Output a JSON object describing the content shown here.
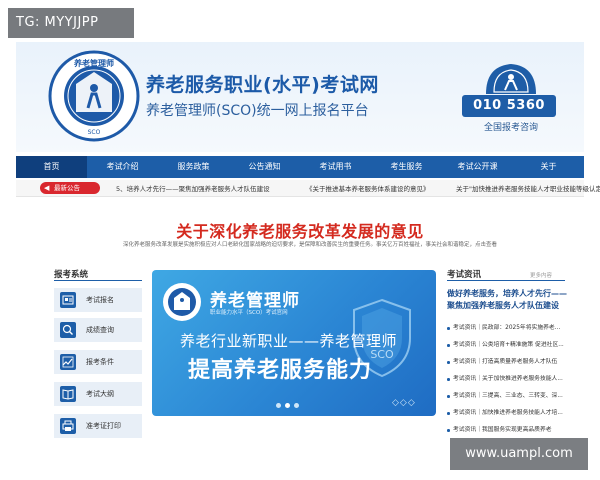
{
  "watermarks": {
    "top_left": "TG: MYYJJPP",
    "bottom_right": "www.uampl.com"
  },
  "header": {
    "title": "养老服务职业(水平)考试网",
    "subtitle": "养老管理师(SCO)统一网上报名平台",
    "logo_top_text": "养老管理师",
    "logo_side_text": "SENIOR CARE SERVICE MANAGER",
    "logo_bottom_text": "SCO",
    "phone": "010 5360 5360",
    "phone_label": "全国报考咨询"
  },
  "nav": {
    "items": [
      "首页",
      "考试介绍",
      "服务政策",
      "公告通知",
      "考试用书",
      "考生服务",
      "考试公开课",
      "关于"
    ],
    "active_index": 0
  },
  "notice": {
    "badge": "最新公告",
    "items": [
      "5、培养人才先行——聚焦加强养老服务人才队伍建设",
      "《关于推进基本养老服务体系建设的意见》",
      "关于\"加快推进养老服务技能人才职业技能等级认定"
    ]
  },
  "headline": "关于深化养老服务改革发展的意见",
  "lead": "深化养老服务改革发展是实施积极应对人口老龄化国家战略的迫切要求，是保障和改善民生的重要任务。事关亿万百姓福祉，事关社会和谐稳定，点击查看",
  "sidebar": {
    "title": "报考系统",
    "items": [
      {
        "label": "考试报名",
        "icon": "id-card-icon"
      },
      {
        "label": "成绩查询",
        "icon": "search-icon"
      },
      {
        "label": "报考条件",
        "icon": "chart-icon"
      },
      {
        "label": "考试大纲",
        "icon": "book-icon"
      },
      {
        "label": "准考证打印",
        "icon": "printer-icon"
      }
    ]
  },
  "banner": {
    "title": "养老管理师",
    "subtitle": "职业能力水平（SCO）考试官网",
    "slogan": "养老行业新职业——养老管理师",
    "main": "提高养老服务能力",
    "shield_text": "SCO",
    "slide_count": 3,
    "active_slide": 1,
    "arrows": "◇◇◇"
  },
  "news": {
    "title": "考试资讯",
    "more": "更多内容",
    "feature": "做好养老服务，培养人才先行——聚焦加强养老服务人才队伍建设",
    "items": [
      "考试资讯｜民政部：2025年将实施养老...",
      "考试资讯｜公类培育+精准施策 促进社区...",
      "考试资讯｜打造高质量养老服务人才队伍",
      "考试资讯｜关于加快推进养老服务技能人...",
      "考试资讯｜三提高、三业态、三转变、深...",
      "考试资讯｜加快推进养老服务技能人才培...",
      "考试资讯｜我国服务实现更高品质养老"
    ]
  },
  "colors": {
    "primary": "#1d5ea8",
    "headline": "#d42a1f",
    "notice_badge": "#d9272e"
  }
}
